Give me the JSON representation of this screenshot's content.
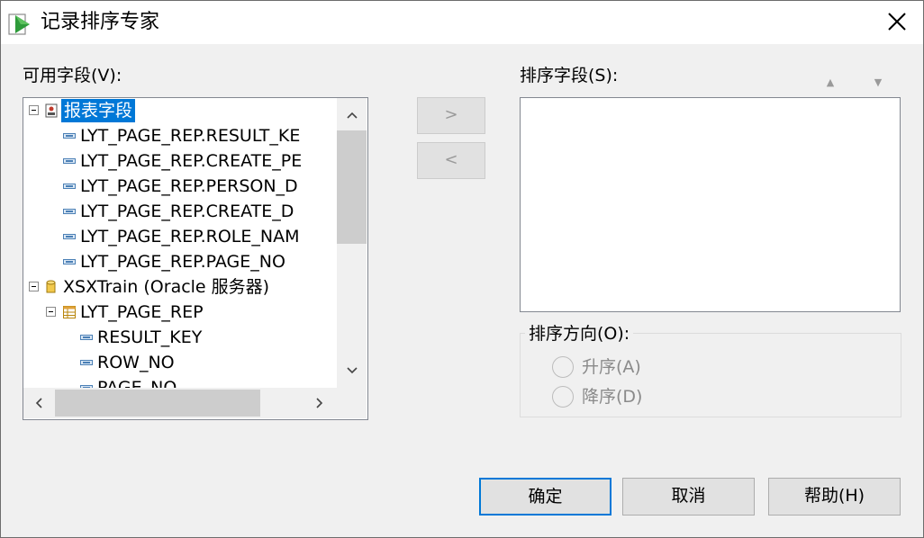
{
  "window": {
    "title": "记录排序专家",
    "close_glyph": "✕"
  },
  "available": {
    "label": "可用字段(V):",
    "tree": {
      "report_root": "报表字段",
      "report_fields": [
        "LYT_PAGE_REP.RESULT_KE",
        "LYT_PAGE_REP.CREATE_PE",
        "LYT_PAGE_REP.PERSON_D",
        "LYT_PAGE_REP.CREATE_D",
        "LYT_PAGE_REP.ROLE_NAM",
        "LYT_PAGE_REP.PAGE_NO"
      ],
      "datasource": "XSXTrain (Oracle 服务器)",
      "table": "LYT_PAGE_REP",
      "table_fields": [
        "RESULT_KEY",
        "ROW_NO",
        "PAGE_NO"
      ]
    }
  },
  "move": {
    "add_label": ">",
    "remove_label": "<"
  },
  "sort": {
    "label": "排序字段(S):",
    "up_arrow": "▲",
    "down_arrow": "▼"
  },
  "direction": {
    "label": "排序方向(O):",
    "ascending": "升序(A)",
    "descending": "降序(D)"
  },
  "buttons": {
    "ok": "确定",
    "cancel": "取消",
    "help": "帮助(H)"
  },
  "colors": {
    "selection": "#0078d7",
    "disabled_text": "#9a9a9a"
  }
}
